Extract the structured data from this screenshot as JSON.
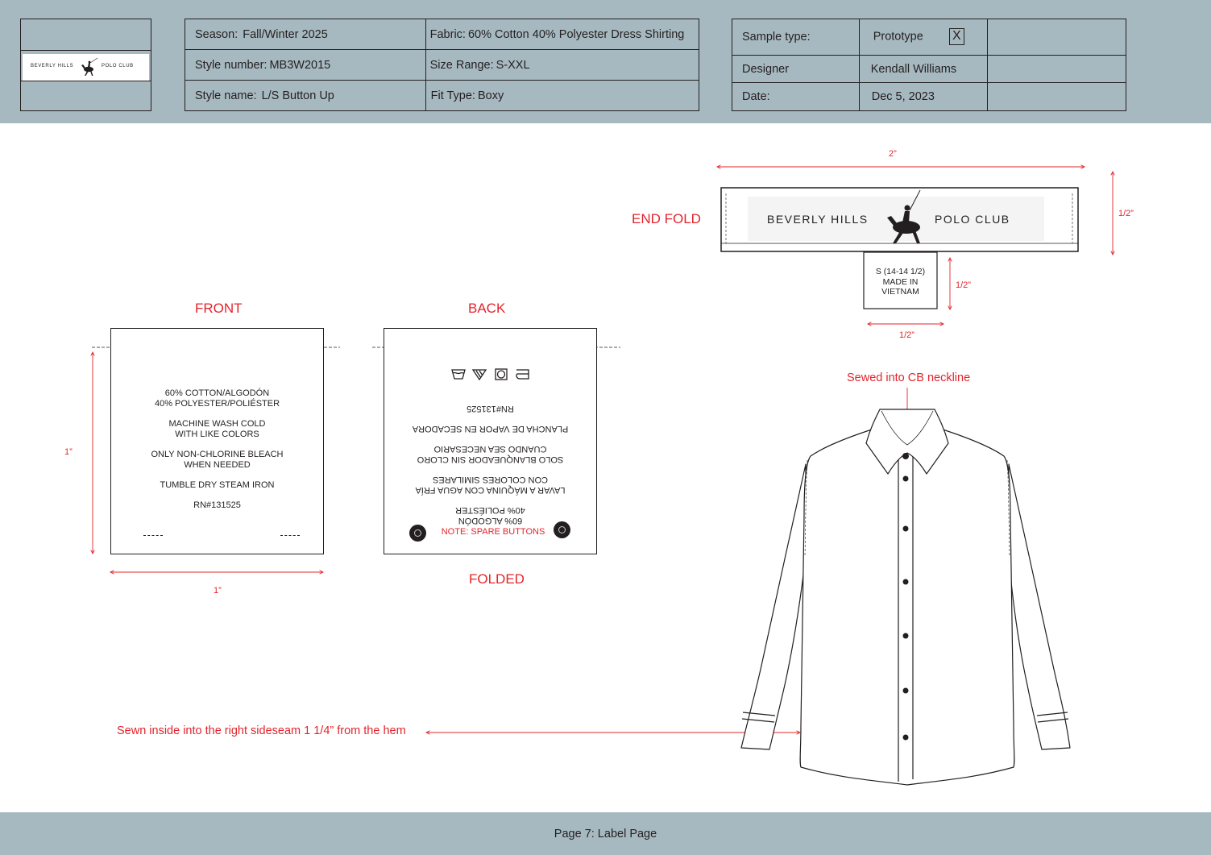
{
  "header": {
    "logo_text": "BEVERLY HILLS POLO CLUB",
    "season": {
      "label": "Season:",
      "value": "Fall/Winter 2025"
    },
    "style_number": {
      "label": "Style number:",
      "value": "MB3W2015"
    },
    "style_name": {
      "label": "Style name:",
      "value": "L/S Button Up"
    },
    "fabric": {
      "label": "Fabric:",
      "value": "60% Cotton 40% Polyester Dress Shirting"
    },
    "size_range": {
      "label": "Size Range:",
      "value": "S-XXL"
    },
    "fit_type": {
      "label": "Fit Type:",
      "value": "Boxy"
    },
    "sample_type": {
      "label": "Sample type:",
      "value": "Prototype",
      "checkbox": "X"
    },
    "designer": {
      "label": "Designer",
      "value": "Kendall Williams"
    },
    "date": {
      "label": "Date:",
      "value": "Dec 5, 2023"
    }
  },
  "labels": {
    "end_fold": {
      "title": "END FOLD",
      "brand_left": "BEVERLY HILLS",
      "brand_right": "POLO CLUB",
      "width_dim": "2”",
      "height_dim": "1/2”",
      "size_tab": {
        "line1": "S (14-14 1/2)",
        "line2": "MADE IN",
        "line3": "VIETNAM",
        "height_dim": "1/2”",
        "width_dim": "1/2”"
      }
    },
    "front": {
      "title": "FRONT",
      "lines": [
        "60% COTTON/ALGODÓN",
        "40% POLYESTER/POLIÉSTER",
        "MACHINE WASH COLD",
        "WITH LIKE COLORS",
        "ONLY NON-CHLORINE BLEACH",
        "WHEN NEEDED",
        "TUMBLE DRY STEAM IRON",
        "RN#131525"
      ],
      "height_dim": "1”",
      "width_dim": "1”"
    },
    "back": {
      "title": "BACK",
      "care_icons": [
        "wash-icon",
        "bleach-icon",
        "tumble-dry-icon",
        "iron-icon"
      ],
      "lines_upside_down": [
        "RN#131525",
        "PLANCHA DE VAPOR EN SECADORA",
        "CUANDO SEA NECESARIO",
        "SOLO BLANQUEADOR SIN CLORO",
        "CON COLORES SIMILARES",
        "LAVAR A MÁQUINA CON AGUA FRÍA",
        "40% POLIÉSTER",
        "60% ALGODÓN"
      ],
      "note": "NOTE: SPARE BUTTONS",
      "footer_title": "FOLDED"
    }
  },
  "annotations": {
    "neckline": "Sewed into CB neckline",
    "sideseam": "Sewn inside into the right sideseam 1 1/4” from the hem"
  },
  "footer": {
    "page": "Page 7: Label Page"
  },
  "colors": {
    "header_band": "#a7b9c0",
    "annotation_red": "#e3242b",
    "ink": "#231f20"
  }
}
